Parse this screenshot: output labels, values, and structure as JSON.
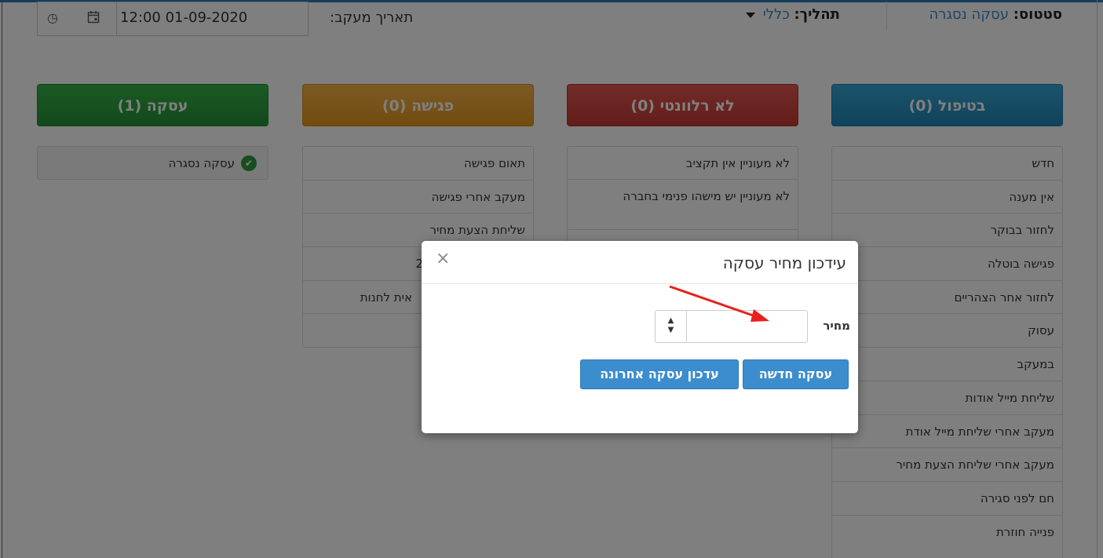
{
  "header": {
    "status_label": "סטטוס:",
    "status_value": "עסקה נסגרה",
    "process_label": "תהליך:",
    "process_value": "כללי",
    "tracking_label": "תאריך מעקב:",
    "tracking_date": "12:00 01-09-2020"
  },
  "columns": [
    {
      "header": "בטיפול (0)",
      "items": [
        "חדש",
        "אין מענה",
        "לחזור בבוקר",
        "פגישה בוטלה",
        "לחזור אחר הצהריים",
        "עסוק",
        "במעקב",
        "שליחת מייל אודות",
        "מעקב אחרי שליחת מייל אודת",
        "מעקב אחרי שליחת הצעת מחיר",
        "חם לפני סגירה",
        "פנייה חוזרת"
      ]
    },
    {
      "header": "לא רלוונטי (0)",
      "items": [
        "לא מעוניין אין תקציב",
        "לא מעוניין יש מישהו פנימי בחברה"
      ]
    },
    {
      "header": "פגישה (0)",
      "items": [
        "תאום פגישה",
        "מעקב אחרי פגישה",
        "שליחת הצעת מחיר",
        "2",
        "אית לחנות"
      ]
    },
    {
      "header": "עסקה (1)",
      "items": [
        "עסקה נסגרה"
      ]
    }
  ],
  "modal": {
    "title": "עידכון מחיר עסקה",
    "close": "×",
    "price_label": "מחיר",
    "price_value": "",
    "new_deal_button": "עסקה חדשה",
    "update_last_button": "עדכון עסקה אחרונה"
  },
  "colors": {
    "accent": "#3c8dcd",
    "treat": "#2186b8",
    "irrelevant": "#c63a33",
    "meeting": "#e7971f",
    "deal": "#269336"
  }
}
